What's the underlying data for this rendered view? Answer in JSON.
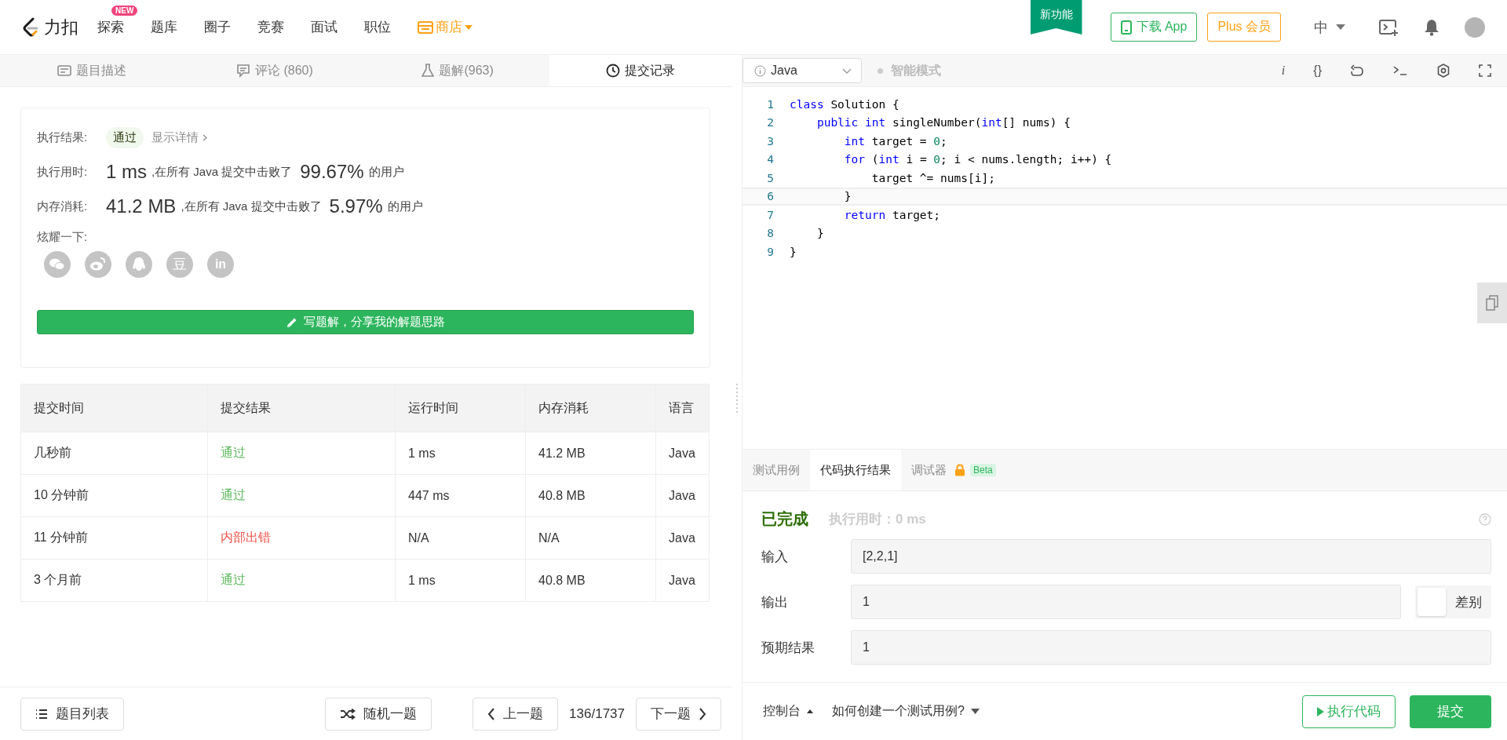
{
  "nav": {
    "logo_text": "力扣",
    "items": [
      {
        "label": "探索",
        "kind": "plain",
        "badge": "NEW"
      },
      {
        "label": "题库",
        "kind": "plain"
      },
      {
        "label": "圈子",
        "kind": "plain"
      },
      {
        "label": "竞赛",
        "kind": "plain"
      },
      {
        "label": "面试",
        "kind": "plain"
      },
      {
        "label": "职位",
        "kind": "plain"
      },
      {
        "label": "商店",
        "kind": "store"
      }
    ],
    "new_feature": "新功能",
    "download": "下载 App",
    "plus": "Plus 会员",
    "language": "中"
  },
  "left_tabs": [
    {
      "label": "题目描述",
      "selected": false
    },
    {
      "label": "评论 (860)",
      "selected": false
    },
    {
      "label": "题解(963)",
      "selected": false
    },
    {
      "label": "提交记录",
      "selected": true
    }
  ],
  "result": {
    "label": "执行结果:",
    "status": "通过",
    "details": "显示详情",
    "stats": [
      {
        "label": "执行用时:",
        "value": "1 ms",
        "middle": ",在所有 Java 提交中击败了",
        "percent": "99.67%",
        "suffix": "的用户"
      },
      {
        "label": "内存消耗:",
        "value": "41.2 MB",
        "middle": ",在所有 Java 提交中击败了",
        "percent": "5.97%",
        "suffix": "的用户"
      }
    ],
    "share_label": "炫耀一下:",
    "share": [
      {
        "kind": "wechat"
      },
      {
        "kind": "weibo"
      },
      {
        "kind": "qq"
      },
      {
        "kind": "douban",
        "glyph": "豆"
      },
      {
        "kind": "linkedin",
        "glyph": "in"
      }
    ],
    "write_button": "写题解，分享我的解题思路"
  },
  "table": {
    "columns": [
      "提交时间",
      "提交结果",
      "运行时间",
      "内存消耗",
      "语言"
    ],
    "rows": [
      {
        "time": "几秒前",
        "result": "通过",
        "kind": "passed",
        "runtime": "1 ms",
        "memory": "41.2 MB",
        "language": "Java"
      },
      {
        "time": "10 分钟前",
        "result": "通过",
        "kind": "passed",
        "runtime": "447 ms",
        "memory": "40.8 MB",
        "language": "Java"
      },
      {
        "time": "11 分钟前",
        "result": "内部出错",
        "kind": "error",
        "runtime": "N/A",
        "memory": "N/A",
        "language": "Java"
      },
      {
        "time": "3 个月前",
        "result": "通过",
        "kind": "passed",
        "runtime": "1 ms",
        "memory": "40.8 MB",
        "language": "Java"
      }
    ]
  },
  "left_footer": {
    "list": "题目列表",
    "random": "随机一题",
    "prev": "上一题",
    "counter": "136/1737",
    "next": "下一题"
  },
  "editor_toolbar": {
    "language": "Java",
    "smart_mode": "智能模式",
    "tools": [
      {
        "kind": "glyph",
        "glyph": "i"
      },
      {
        "kind": "glyph",
        "glyph": "{}"
      },
      {
        "kind": "reset"
      },
      {
        "kind": "terminal"
      },
      {
        "kind": "settings"
      },
      {
        "kind": "fullscreen"
      }
    ]
  },
  "code": [
    {
      "number": "1",
      "selected": false,
      "tokens": [
        {
          "text": "class",
          "kind": "keyword"
        },
        {
          "text": " Solution {",
          "kind": "plain"
        }
      ]
    },
    {
      "number": "2",
      "selected": false,
      "tokens": [
        {
          "text": "    public int",
          "kind": "keyword"
        },
        {
          "text": " singleNumber(",
          "kind": "plain"
        },
        {
          "text": "int",
          "kind": "keyword"
        },
        {
          "text": "[] nums) {",
          "kind": "plain"
        }
      ]
    },
    {
      "number": "3",
      "selected": false,
      "tokens": [
        {
          "text": "        int",
          "kind": "keyword"
        },
        {
          "text": " target = ",
          "kind": "plain"
        },
        {
          "text": "0",
          "kind": "number"
        },
        {
          "text": ";",
          "kind": "plain"
        }
      ]
    },
    {
      "number": "4",
      "selected": false,
      "tokens": [
        {
          "text": "        for",
          "kind": "keyword"
        },
        {
          "text": " (",
          "kind": "plain"
        },
        {
          "text": "int",
          "kind": "keyword"
        },
        {
          "text": " i = ",
          "kind": "plain"
        },
        {
          "text": "0",
          "kind": "number"
        },
        {
          "text": "; i < nums.length; i++) {",
          "kind": "plain"
        }
      ]
    },
    {
      "number": "5",
      "selected": false,
      "tokens": [
        {
          "text": "            target ^= nums[i];",
          "kind": "plain"
        }
      ]
    },
    {
      "number": "6",
      "selected": true,
      "tokens": [
        {
          "text": "        }",
          "kind": "plain"
        }
      ]
    },
    {
      "number": "7",
      "selected": false,
      "tokens": [
        {
          "text": "        return",
          "kind": "keyword"
        },
        {
          "text": " target;",
          "kind": "plain"
        }
      ]
    },
    {
      "number": "8",
      "selected": false,
      "tokens": [
        {
          "text": "    }",
          "kind": "plain"
        }
      ]
    },
    {
      "number": "9",
      "selected": false,
      "tokens": [
        {
          "text": "}",
          "kind": "plain"
        }
      ]
    }
  ],
  "console_tabs": [
    {
      "label": "测试用例",
      "selected": false,
      "locked": false
    },
    {
      "label": "代码执行结果",
      "selected": true,
      "locked": false
    },
    {
      "label": "调试器",
      "selected": false,
      "locked": true,
      "badge": "Beta"
    }
  ],
  "run_result": {
    "status": "已完成",
    "time": "执行用时：0 ms",
    "fields": [
      {
        "label": "输入",
        "value": "[2,2,1]"
      },
      {
        "label": "输出",
        "value": "1",
        "diff": {
          "label": "差别",
          "on": false
        }
      },
      {
        "label": "预期结果",
        "value": "1"
      }
    ]
  },
  "right_footer": {
    "console": "控制台",
    "help": "如何创建一个测试用例?",
    "run": "执行代码",
    "submit": "提交"
  }
}
